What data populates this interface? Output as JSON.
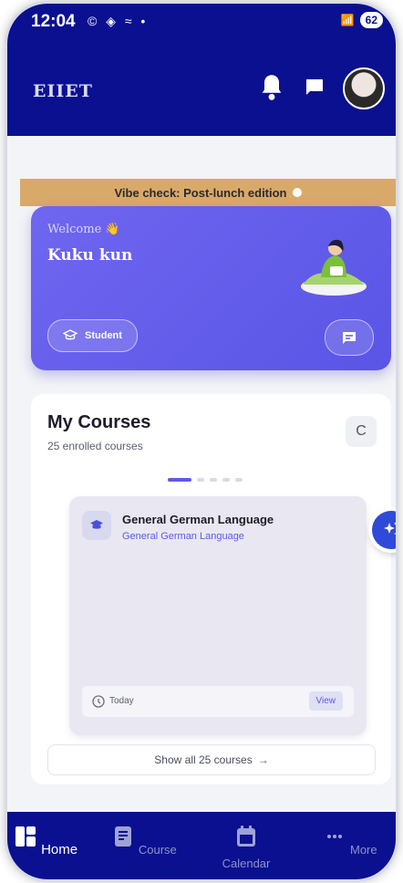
{
  "status_bar": {
    "time": "12:04",
    "status_icons": "© ◈ ≈ •",
    "signal": "📶",
    "battery": "62"
  },
  "app_bar": {
    "brand": "EIIET"
  },
  "banner": {
    "text": "Vibe check: Post-lunch edition"
  },
  "welcome_card": {
    "greeting": "Welcome 👋",
    "name": "Kuku kun",
    "role_label": "Student"
  },
  "courses": {
    "title": "My Courses",
    "subtitle": "25 enrolled courses",
    "refresh_icon": "C",
    "pager": {
      "total": 5,
      "active": 0
    },
    "card": {
      "title": "General German Language",
      "subtitle": "General German Language",
      "date": "Today",
      "view_label": "View"
    },
    "show_all_label": "Show all 25 courses",
    "show_all_arrow": "→"
  },
  "bottom_nav": [
    {
      "label": "Home",
      "active": true
    },
    {
      "label": "Course",
      "active": false
    },
    {
      "label": "Calendar",
      "active": false
    },
    {
      "label": "More",
      "active": false
    }
  ],
  "colors": {
    "primary": "#0a1090",
    "accent": "#5e59e8",
    "banner": "#d9a96a"
  }
}
